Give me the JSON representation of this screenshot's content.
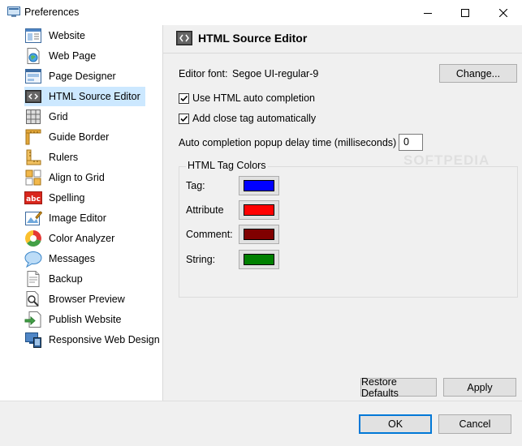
{
  "window": {
    "title": "Preferences",
    "icon": "preferences-window-icon"
  },
  "sidebar": {
    "items": [
      {
        "label": "Website",
        "icon": "website-icon"
      },
      {
        "label": "Web Page",
        "icon": "web-page-icon"
      },
      {
        "label": "Page Designer",
        "icon": "page-designer-icon"
      },
      {
        "label": "HTML Source Editor",
        "icon": "html-source-editor-icon",
        "selected": true
      },
      {
        "label": "Grid",
        "icon": "grid-icon"
      },
      {
        "label": "Guide Border",
        "icon": "guide-border-icon"
      },
      {
        "label": "Rulers",
        "icon": "rulers-icon"
      },
      {
        "label": "Align to Grid",
        "icon": "align-to-grid-icon"
      },
      {
        "label": "Spelling",
        "icon": "spelling-icon",
        "icon_text": "abc"
      },
      {
        "label": "Image Editor",
        "icon": "image-editor-icon"
      },
      {
        "label": "Color Analyzer",
        "icon": "color-analyzer-icon"
      },
      {
        "label": "Messages",
        "icon": "messages-icon"
      },
      {
        "label": "Backup",
        "icon": "backup-icon"
      },
      {
        "label": "Browser Preview",
        "icon": "browser-preview-icon"
      },
      {
        "label": "Publish Website",
        "icon": "publish-website-icon"
      },
      {
        "label": "Responsive Web Design",
        "icon": "responsive-web-design-icon"
      }
    ]
  },
  "panel": {
    "title": "HTML Source Editor",
    "editor_font_label": "Editor font:",
    "editor_font_value": "Segoe UI-regular-9",
    "change_button": "Change...",
    "auto_completion": {
      "label": "Use HTML auto completion",
      "checked": true
    },
    "close_tag": {
      "label": "Add close tag automatically",
      "checked": true
    },
    "delay_label": "Auto completion popup delay time (milliseconds)",
    "delay_value": "0",
    "tag_colors": {
      "title": "HTML Tag Colors",
      "items": [
        {
          "label": "Tag:",
          "color": "#0000ff"
        },
        {
          "label": "Attribute",
          "color": "#ff0000"
        },
        {
          "label": "Comment:",
          "color": "#800000"
        },
        {
          "label": "String:",
          "color": "#008000"
        }
      ]
    },
    "restore_defaults_button": "Restore Defaults",
    "apply_button": "Apply",
    "watermark": "SOFTPEDIA"
  },
  "footer": {
    "ok_button": "OK",
    "cancel_button": "Cancel"
  },
  "colors": {
    "selection": "#cce8ff",
    "accent": "#0078d7",
    "panel_bg": "#f0f0f0"
  }
}
